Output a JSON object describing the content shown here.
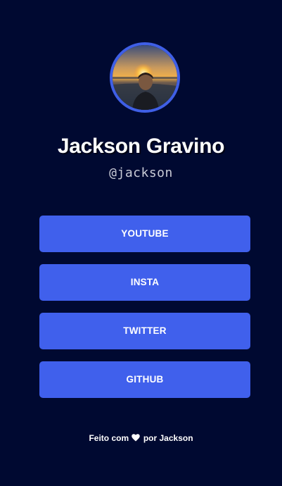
{
  "profile": {
    "avatar_alt": "Jackson Gravino",
    "name": "Jackson Gravino",
    "handle": "@jackson"
  },
  "links": [
    {
      "label": "YOUTUBE"
    },
    {
      "label": "INSTA"
    },
    {
      "label": "TWITTER"
    },
    {
      "label": "GITHUB"
    }
  ],
  "footer": {
    "prefix": "Feito com",
    "icon": "heart-icon",
    "suffix": "por Jackson"
  },
  "colors": {
    "background": "#000931",
    "button": "#4060ec",
    "avatar_ring": "#3f5fe6"
  }
}
